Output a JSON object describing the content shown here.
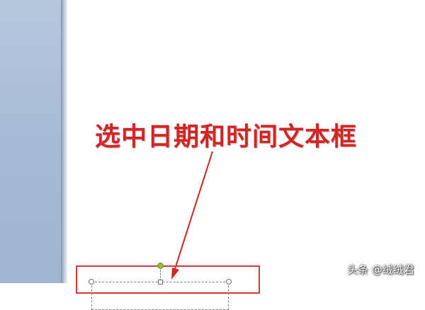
{
  "annotation": {
    "text": "选中日期和时间文本框",
    "color": "#d42424"
  },
  "watermark": {
    "text": "头条 @绒绒君"
  },
  "colors": {
    "highlight_border": "#d63a3a",
    "arrow": "#d42424",
    "rotation_handle": "#9bbb3a",
    "side_pane": "#a7bcd6"
  },
  "icons": {
    "rotation_handle": "green-circle-handle",
    "resize_handle": "white-circle-handle"
  }
}
